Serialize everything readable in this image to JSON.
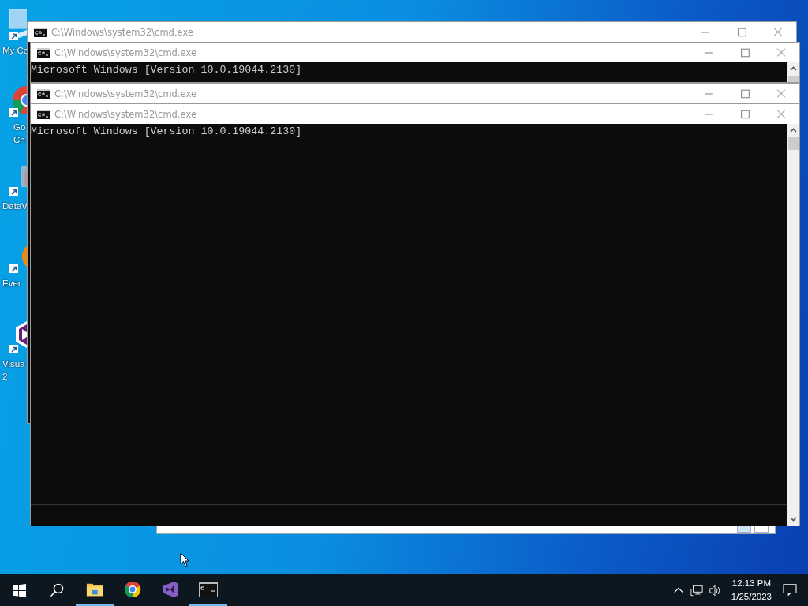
{
  "desktop_icons": [
    {
      "kind": "computer",
      "lines": [
        "My Co"
      ]
    },
    {
      "kind": "chrome",
      "lines": [
        "Go",
        "Ch"
      ]
    },
    {
      "kind": "data",
      "lines": [
        "DataV"
      ]
    },
    {
      "kind": "note",
      "lines": [
        "Ever"
      ]
    },
    {
      "kind": "studio",
      "lines": [
        "Visua",
        "2"
      ]
    }
  ],
  "explorer_status": {
    "kind": "status-bar"
  },
  "windows": [
    {
      "title": "C:\\Windows\\system32\\cmd.exe"
    },
    {
      "title": "C:\\Windows\\system32\\cmd.exe",
      "console_lines": [
        "Microsoft Windows [Version 10.0.19044.2130]"
      ]
    },
    {
      "title": "C:\\Windows\\system32\\cmd.exe"
    },
    {
      "title": "C:\\Windows\\system32\\cmd.exe",
      "console_lines": [
        "Microsoft Windows [Version 10.0.19044.2130]"
      ]
    }
  ],
  "taskbar": {
    "apps": [
      {
        "kind": "explorer",
        "running": true
      },
      {
        "kind": "chrome",
        "running": false
      },
      {
        "kind": "studio",
        "running": false
      },
      {
        "kind": "console",
        "running": true
      }
    ],
    "time": "12:13 PM",
    "date": "1/25/2023"
  }
}
